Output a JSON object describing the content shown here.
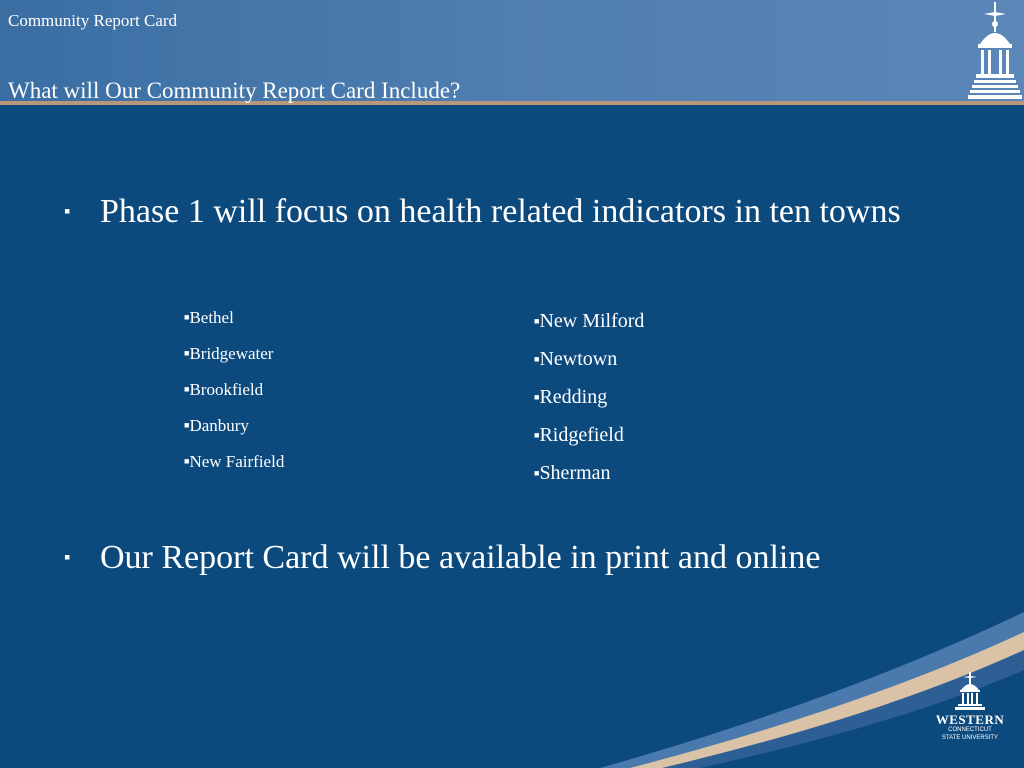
{
  "header": {
    "small_title": "Community Report Card",
    "slide_title": "What will Our Community Report Card Include?"
  },
  "bullets": [
    {
      "marker": "▪",
      "text": "Phase 1 will focus on health related indicators in ten towns"
    },
    {
      "marker": "▪",
      "text": "Our Report Card will be available in print and online"
    }
  ],
  "towns_col1": [
    "Bethel",
    "Bridgewater",
    "Brookfield",
    "Danbury",
    "New Fairfield"
  ],
  "towns_col2": [
    "New Milford",
    "Newtown",
    "Redding",
    "Ridgefield",
    "Sherman"
  ],
  "logo": {
    "brand": "WESTERN",
    "sub1": "CONNECTICUT",
    "sub2": "STATE UNIVERSITY"
  },
  "colors": {
    "background": "#0c4a7e",
    "header": "#4f7eb0",
    "accent_line": "#b8977a"
  }
}
